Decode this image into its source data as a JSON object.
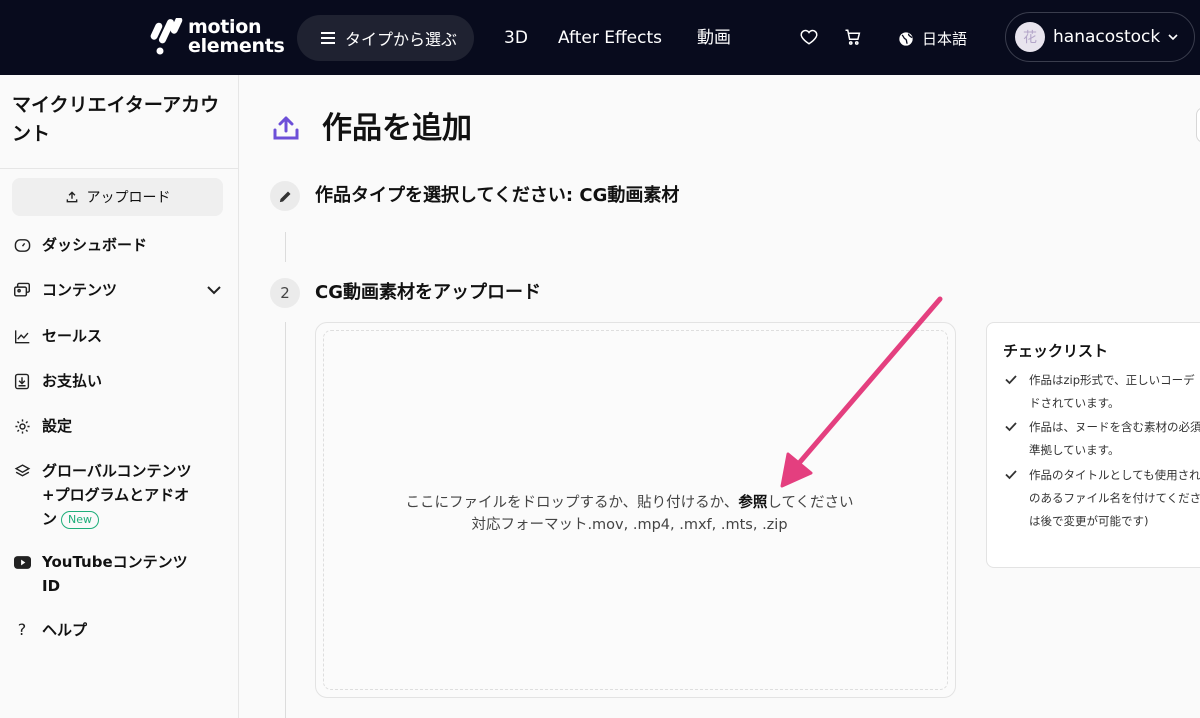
{
  "header": {
    "logo_line1": "motion",
    "logo_line2": "elements",
    "type_menu_label": "タイプから選ぶ",
    "nav": [
      "3D",
      "After Effects",
      "動画"
    ],
    "language": "日本語",
    "username": "hanacostock",
    "avatar_char": "花"
  },
  "sidebar": {
    "title": "マイクリエイターアカウント",
    "upload_label": "アップロード",
    "items": [
      {
        "label": "ダッシュボード",
        "icon": "dashboard-icon"
      },
      {
        "label": "コンテンツ",
        "icon": "content-icon"
      },
      {
        "label": "セールス",
        "icon": "chart-line-icon"
      },
      {
        "label": "お支払い",
        "icon": "payment-icon"
      },
      {
        "label": "設定",
        "icon": "gear-icon"
      },
      {
        "label_line1": "グローバルコンテンツ",
        "label_line2": "+プログラムとアドオ",
        "label_line3": "ン",
        "badge": "New",
        "icon": "layers-icon"
      },
      {
        "label_line1": "YouTubeコンテンツ",
        "label_line2": "ID",
        "icon": "youtube-icon"
      },
      {
        "label": "ヘルプ",
        "icon": "help-icon"
      }
    ]
  },
  "main": {
    "title": "作品を追加",
    "step1_title": "作品タイプを選択してください: CG動画素材",
    "step2_number": "2",
    "step2_title": "CG動画素材をアップロード",
    "drop_text_before": "ここにファイルをドロップするか、貼り付けるか、",
    "drop_text_link": "参照",
    "drop_text_after": "してください",
    "drop_formats": "対応フォーマット.mov, .mp4, .mxf, .mts, .zip"
  },
  "checklist": {
    "title": "チェックリスト",
    "items": [
      {
        "line1": "作品はzip形式で、正しいコーデ",
        "line2": "ドされています。"
      },
      {
        "line1": "作品は、ヌードを含む素材の必須",
        "line2": "準拠しています。"
      },
      {
        "line1": "作品のタイトルとしても使用され",
        "line2": "のあるファイル名を付けてくださ",
        "line3": "は後で変更が可能です)"
      }
    ]
  },
  "colors": {
    "header_bg": "#080b1d",
    "accent_purple": "#6c4fd8",
    "annotation_arrow": "#e43f7f",
    "new_badge": "#1fae7a"
  }
}
